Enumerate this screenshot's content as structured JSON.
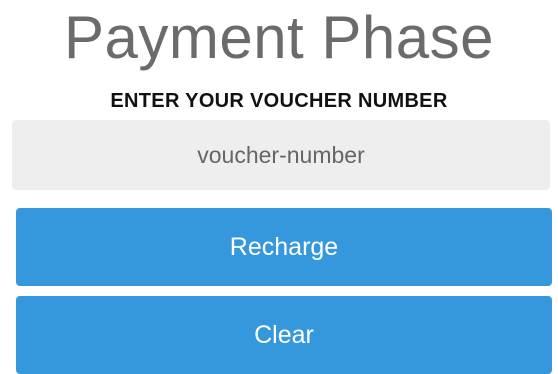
{
  "header": {
    "title": "Payment Phase"
  },
  "voucher_form": {
    "label": "ENTER YOUR VOUCHER NUMBER",
    "input_value": "",
    "input_placeholder": "voucher-number",
    "recharge_label": "Recharge",
    "clear_label": "Clear"
  },
  "colors": {
    "title_text": "#6b6b6b",
    "input_background": "#eeeeee",
    "button_background": "#3598dc",
    "button_text": "#ffffff"
  }
}
